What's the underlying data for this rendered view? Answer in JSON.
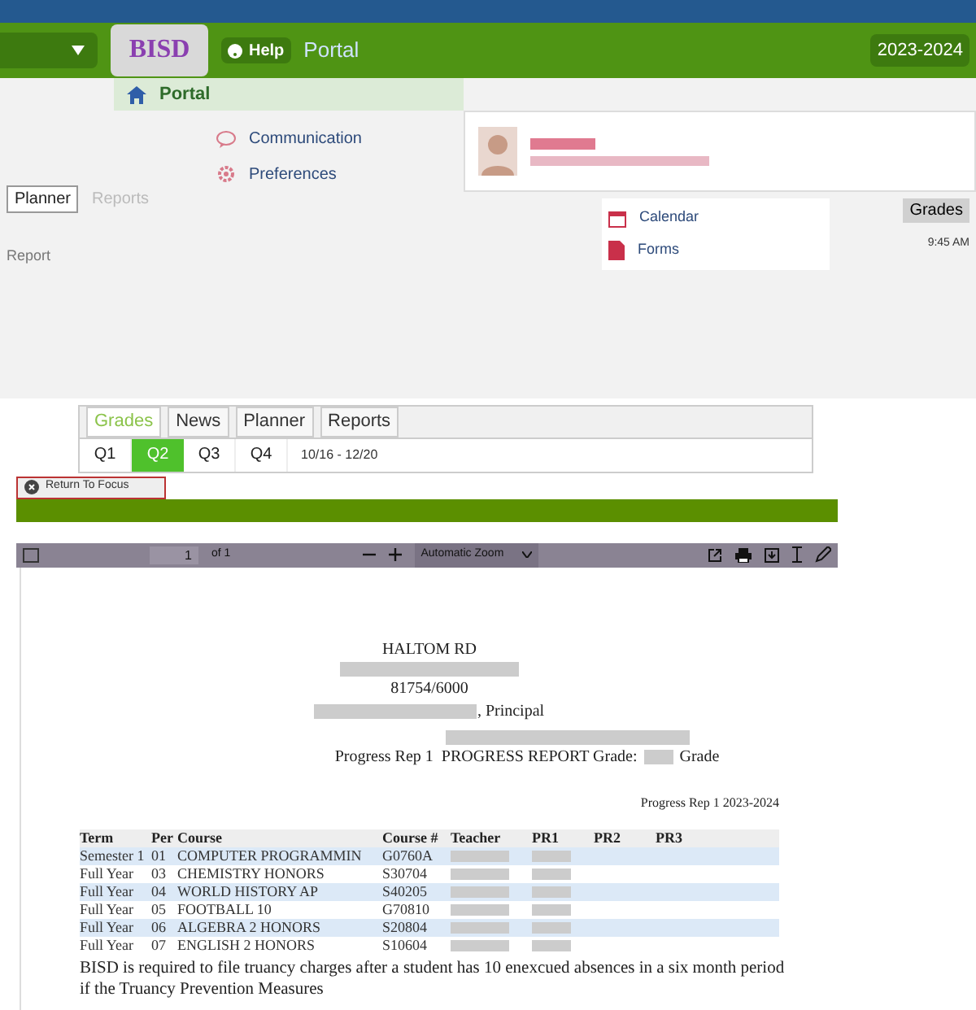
{
  "header": {
    "logo": "BISD",
    "help": "Help",
    "title": "Portal",
    "year": "2023-2024"
  },
  "nav": {
    "portal": "Portal",
    "menu": [
      {
        "label": "Communication",
        "kind": "chat"
      },
      {
        "label": "Preferences",
        "kind": "gear"
      }
    ],
    "menu2": [
      {
        "label": "Calendar",
        "kind": "calendar"
      },
      {
        "label": "Forms",
        "kind": "form"
      }
    ]
  },
  "upper_tabs": [
    {
      "label": "Planner",
      "selected": true
    },
    {
      "label": "Reports",
      "selected": false
    }
  ],
  "right_tab": "Grades",
  "report_label": "Report",
  "time": "9:45 AM",
  "tabs": [
    {
      "label": "Grades",
      "selected": true
    },
    {
      "label": "News",
      "selected": false
    },
    {
      "label": "Planner",
      "selected": false
    },
    {
      "label": "Reports",
      "selected": false
    }
  ],
  "quarters": [
    {
      "label": "Q1",
      "selected": false
    },
    {
      "label": "Q2",
      "selected": true
    },
    {
      "label": "Q3",
      "selected": false
    },
    {
      "label": "Q4",
      "selected": false
    }
  ],
  "date_range": "10/16 - 12/20",
  "return_button": "Return To Focus",
  "pdf_toolbar": {
    "page": "1",
    "page_count": "of 1",
    "zoom": "Automatic Zoom"
  },
  "document": {
    "address": "HALTOM RD",
    "phone": "81754/6000",
    "principal": ", Principal",
    "report_title": "Progress Rep 1  PROGRESS REPORT Grade:",
    "grade_suffix": "Grade",
    "period": "Progress Rep 1 2023-2024",
    "columns": [
      "Term",
      "Per",
      "Course",
      "Course #",
      "Teacher",
      "PR1",
      "PR2",
      "PR3"
    ],
    "rows": [
      [
        "Semester 1",
        "01",
        "COMPUTER PROGRAMMIN",
        "G0760A"
      ],
      [
        "Full Year",
        "03",
        "CHEMISTRY HONORS",
        "S30704"
      ],
      [
        "Full Year",
        "04",
        "WORLD HISTORY AP",
        "S40205"
      ],
      [
        "Full Year",
        "05",
        "FOOTBALL 10",
        "G70810"
      ],
      [
        "Full Year",
        "06",
        "ALGEBRA 2 HONORS",
        "S20804"
      ],
      [
        "Full Year",
        "07",
        "ENGLISH 2 HONORS",
        "S10604"
      ]
    ],
    "notice": "BISD is required to file truancy charges after a student has 10 enexcued absences in a six month period if the Truancy Prevention Measures"
  }
}
